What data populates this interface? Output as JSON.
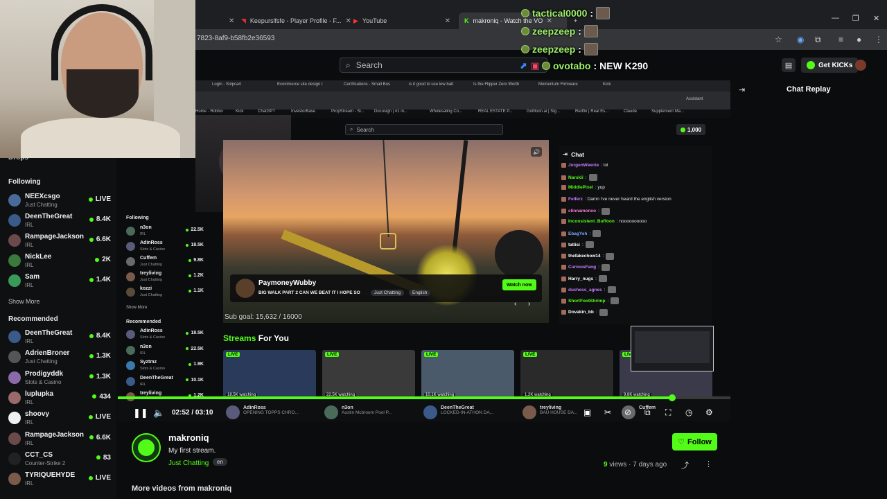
{
  "browser": {
    "tabs": [
      {
        "label": "Keepurslfsfe - Player Profile - F..."
      },
      {
        "label": "YouTube"
      },
      {
        "label": "makroniq - Watch the VOD"
      }
    ],
    "url": "7823-8af9-b58fb2e36593"
  },
  "overlay_chat": [
    {
      "name": "tactical0000",
      "sep": ":",
      "msg": ""
    },
    {
      "name": "zeepzeep",
      "sep": ":",
      "msg": ""
    },
    {
      "name": "zeepzeep",
      "sep": ":",
      "msg": ""
    },
    {
      "name": "ovotabo",
      "sep": ":",
      "msg": "NEW K290"
    }
  ],
  "header": {
    "search_placeholder": "Search",
    "get_kicks": "Get KICKs"
  },
  "sidebar": {
    "partial_label": "Drops",
    "following_title": "Following",
    "following": [
      {
        "name": "NEEXcsgo",
        "cat": "Just Chatting",
        "viewers": "LIVE",
        "color": "#4a6a9a"
      },
      {
        "name": "DeenTheGreat",
        "cat": "IRL",
        "viewers": "8.4K",
        "color": "#3a5a8a"
      },
      {
        "name": "RampageJackson",
        "cat": "IRL",
        "viewers": "6.6K",
        "color": "#6a4a4a"
      },
      {
        "name": "NickLee",
        "cat": "IRL",
        "viewers": "2K",
        "color": "#3a7a3a"
      },
      {
        "name": "Sam",
        "cat": "IRL",
        "viewers": "1.4K",
        "color": "#3a9a5a"
      }
    ],
    "show_more": "Show More",
    "recommended_title": "Recommended",
    "recommended": [
      {
        "name": "DeenTheGreat",
        "cat": "IRL",
        "viewers": "8.4K",
        "color": "#3a5a8a"
      },
      {
        "name": "AdrienBroner",
        "cat": "Just Chatting",
        "viewers": "1.3K",
        "color": "#555"
      },
      {
        "name": "Prodigyddk",
        "cat": "Slots & Casino",
        "viewers": "1.3K",
        "color": "#8a6aaa"
      },
      {
        "name": "luplupka",
        "cat": "IRL",
        "viewers": "434",
        "color": "#9a6a6a"
      },
      {
        "name": "shoovy",
        "cat": "IRL",
        "viewers": "LIVE",
        "color": "#f0f0f0"
      },
      {
        "name": "RampageJackson",
        "cat": "IRL",
        "viewers": "6.6K",
        "color": "#6a4a4a"
      },
      {
        "name": "CCT_CS",
        "cat": "Counter-Strike 2",
        "viewers": "83",
        "color": "#222"
      },
      {
        "name": "TYRIQUEHYDE",
        "cat": "IRL",
        "viewers": "LIVE",
        "color": "#7a5a4a"
      }
    ]
  },
  "inner": {
    "tabs": [
      "Login - Snipcart",
      "Ecommerce site design t",
      "Certifications - Small Bus",
      "is it good to use low batt",
      "Is the Flipper Zero Worth",
      "Momentum Firmware",
      "Kick"
    ],
    "bookmarks": [
      "Home - Roblox",
      "Kick",
      "ChatGPT",
      "InvestorBase",
      "PropStream - Si...",
      "Docusign | #1 in...",
      "Wholesaling Co...",
      "REAL ESTATE P...",
      "GoMoon.ai | Sig...",
      "Redfin | Real Es...",
      "Claude",
      "Supplement Ma..."
    ],
    "assistant": "Assistant",
    "search_placeholder": "Search",
    "coins": "1,000",
    "following_title": "Following",
    "following": [
      {
        "name": "n3on",
        "cat": "IRL",
        "viewers": "22.5K",
        "color": "#4a6a5a"
      },
      {
        "name": "AdinRoss",
        "cat": "Slots & Casino",
        "viewers": "18.5K",
        "color": "#5a5a7a"
      },
      {
        "name": "Cuffem",
        "cat": "Just Chatting",
        "viewers": "9.8K",
        "color": "#6a6a6a"
      },
      {
        "name": "treyliving",
        "cat": "Just Chatting",
        "viewers": "1.2K",
        "color": "#7a5a4a"
      },
      {
        "name": "kozzi",
        "cat": "Just Chatting",
        "viewers": "1.1K",
        "color": "#5a4a3a"
      }
    ],
    "show_more": "Show More",
    "recommended_title": "Recommended",
    "recommended": [
      {
        "name": "AdinRoss",
        "cat": "Slots & Casino",
        "viewers": "18.5K",
        "color": "#5a5a7a"
      },
      {
        "name": "n3on",
        "cat": "IRL",
        "viewers": "22.5K",
        "color": "#4a6a5a"
      },
      {
        "name": "Syztmz",
        "cat": "Slots & Casino",
        "viewers": "1.9K",
        "color": "#3a7aaa"
      },
      {
        "name": "DeenTheGreat",
        "cat": "IRL",
        "viewers": "10.1K",
        "color": "#3a5a8a"
      },
      {
        "name": "treyliving",
        "cat": "",
        "viewers": "1.2K",
        "color": "#7a5a4a"
      }
    ],
    "featured": {
      "name": "PaymoneyWubby",
      "title": "BIG WALK PART 2 CAN WE BEAT IT I HOPE SO",
      "tags": [
        "Just Chatting",
        "English"
      ],
      "watch_now": "Watch now",
      "sub_goal": "Sub goal: 15,632 / 16000"
    },
    "chat_title": "Chat",
    "chat": [
      {
        "name": "JorgenWeenie",
        "msg": ": lol",
        "color": "#c77dff"
      },
      {
        "name": "Narskii",
        "msg": ":",
        "color": "#53fc18"
      },
      {
        "name": "MiddlePixel",
        "msg": ": yup",
        "color": "#53fc18"
      },
      {
        "name": "Felferz",
        "msg": ": Damn i've never heard the english version",
        "color": "#c77dff"
      },
      {
        "name": "clinnamonxo",
        "msg": ":",
        "color": "#ff7bd5"
      },
      {
        "name": "Inconsistent_Buffoon",
        "msg": ": noooooooooo",
        "color": "#53fc18"
      },
      {
        "name": "EbagYeh",
        "msg": ":",
        "color": "#7aa7ff"
      },
      {
        "name": "tatlisi",
        "msg": ":",
        "color": "#ffffff"
      },
      {
        "name": "thefakechow14",
        "msg": ":",
        "color": "#ffffff"
      },
      {
        "name": "CuriousFang",
        "msg": ":",
        "color": "#c77dff"
      },
      {
        "name": "Harry_nugs",
        "msg": ":",
        "color": "#ffffff"
      },
      {
        "name": "duchess_agnes",
        "msg": ":",
        "color": "#c77dff"
      },
      {
        "name": "ShortFootShrimp",
        "msg": ":",
        "color": "#53fc18"
      },
      {
        "name": "Dovakin_bb",
        "msg": ":",
        "color": "#ffffff"
      }
    ],
    "streams_title_a": "Streams",
    "streams_title_b": "For You",
    "streams": [
      {
        "live": "LIVE",
        "watching": "18.5K watching",
        "bg": "#2a3a5a"
      },
      {
        "live": "LIVE",
        "watching": "22.5K watching",
        "bg": "#3a3a3a"
      },
      {
        "live": "LIVE",
        "watching": "10.1K watching",
        "bg": "#4a5a6a"
      },
      {
        "live": "LIVE",
        "watching": "1.2K watching",
        "bg": "#2a2a2a"
      },
      {
        "live": "LIVE",
        "watching": "9.8K watching",
        "bg": "#3a3a4a"
      }
    ]
  },
  "player": {
    "time": "02:52 / 03:10",
    "progress": 0.905,
    "channels": [
      {
        "name": "AdinRoss",
        "title": "OPENING TOPPS CHRO..."
      },
      {
        "name": "n3on",
        "title": "Austin Mcbroom Pool P..."
      },
      {
        "name": "DeenTheGreat",
        "title": "LOCKED-IN-ATHON DA..."
      },
      {
        "name": "treyliving",
        "title": "BAU HOUSE DA..."
      },
      {
        "name": "Cuffem",
        "title": ""
      }
    ]
  },
  "replay": {
    "title": "Chat Replay"
  },
  "channel": {
    "name": "makroniq",
    "title": "My first stream.",
    "category": "Just Chatting",
    "lang": "en",
    "follow": "Follow",
    "views_count": "9",
    "views_label": "views",
    "sep": "·",
    "ago": "7 days ago",
    "more_videos": "More videos from makroniq"
  },
  "colors": {
    "accent": "#53fc18",
    "bg": "#0b0c0e"
  }
}
